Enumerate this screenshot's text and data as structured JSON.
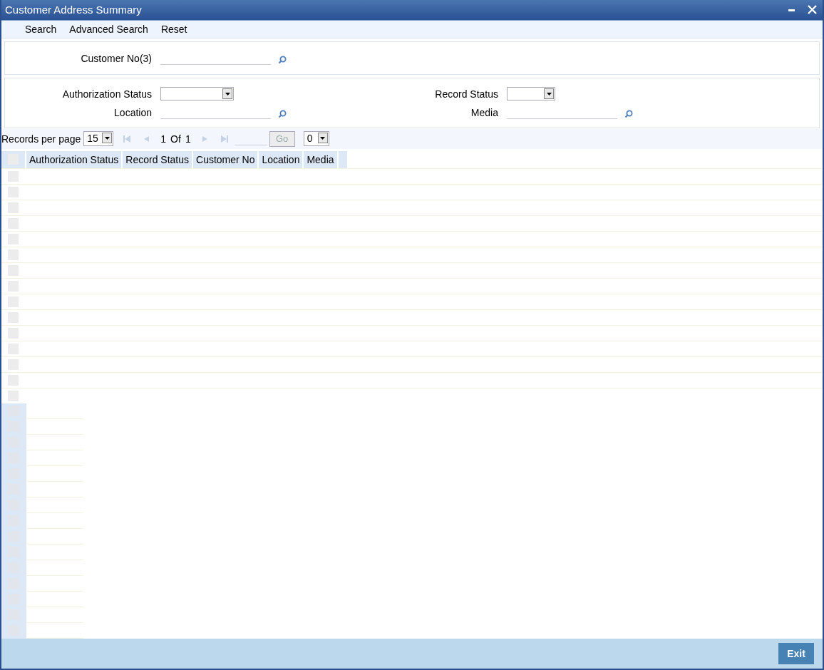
{
  "window": {
    "title": "Customer Address Summary"
  },
  "toolbar": [
    "Search",
    "Advanced Search",
    "Reset"
  ],
  "key_panel": {
    "fields": [
      {
        "label": "Customer No(3)",
        "kind": "lookup"
      }
    ]
  },
  "filter_panel": {
    "left": [
      {
        "label": "Authorization Status",
        "kind": "select"
      },
      {
        "label": "Location",
        "kind": "lookup"
      }
    ],
    "right": [
      {
        "label": "Record Status",
        "kind": "select"
      },
      {
        "label": "Media",
        "kind": "lookup"
      }
    ]
  },
  "pager": {
    "label": "Records per page",
    "per_page": "15",
    "page": "1",
    "of": "Of",
    "total": "1",
    "go": "Go",
    "go_disabled": true,
    "nav_disabled": true,
    "jump": "0"
  },
  "table": {
    "select_all_checked": false,
    "columns": [
      "Authorization Status",
      "Record Status",
      "Customer No",
      "Location",
      "Media"
    ],
    "rows": [
      {
        "checked": false
      },
      {
        "checked": false
      },
      {
        "checked": false
      },
      {
        "checked": false
      },
      {
        "checked": false
      },
      {
        "checked": false
      },
      {
        "checked": false
      },
      {
        "checked": false
      },
      {
        "checked": false
      },
      {
        "checked": false
      },
      {
        "checked": false
      },
      {
        "checked": false
      },
      {
        "checked": false
      },
      {
        "checked": false
      },
      {
        "checked": false
      }
    ]
  },
  "footer": {
    "button": "Exit"
  }
}
